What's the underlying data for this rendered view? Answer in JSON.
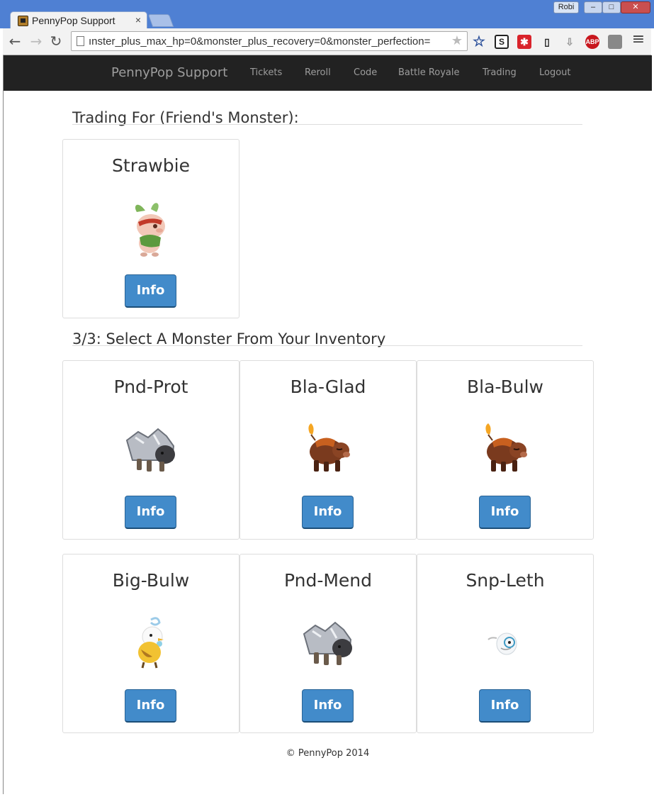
{
  "browser": {
    "tab_title": "PennyPop Support",
    "tab_close": "×",
    "profile_name": "Robi",
    "url": "ınster_plus_max_hp=0&monster_plus_recovery=0&monster_perfection=",
    "back_glyph": "←",
    "forward_glyph": "→",
    "reload_glyph": "↻",
    "menu_glyph": "≡",
    "extensions": [
      "ABP"
    ]
  },
  "nav": {
    "brand": "PennyPop Support",
    "links": [
      "Tickets",
      "Reroll",
      "Code",
      "Battle Royale",
      "Trading",
      "Logout"
    ]
  },
  "trading_for": {
    "title": "Trading For (Friend's Monster):",
    "monster": {
      "name": "Strawbie",
      "button": "Info",
      "icon": "strawbie-pig-icon"
    }
  },
  "inventory": {
    "title": "3/3: Select A Monster From Your Inventory",
    "monsters": [
      {
        "name": "Pnd-Prot",
        "button": "Info",
        "icon": "armored-boar-icon"
      },
      {
        "name": "Bla-Glad",
        "button": "Info",
        "icon": "fire-boar-icon"
      },
      {
        "name": "Bla-Bulw",
        "button": "Info",
        "icon": "fire-boar-icon"
      },
      {
        "name": "Big-Bulw",
        "button": "Info",
        "icon": "wind-bird-icon"
      },
      {
        "name": "Pnd-Mend",
        "button": "Info",
        "icon": "armored-boar-icon"
      },
      {
        "name": "Snp-Leth",
        "button": "Info",
        "icon": "monocle-egg-icon"
      }
    ]
  },
  "footer": {
    "text": "© PennyPop 2014"
  },
  "colors": {
    "navbar": "#222222",
    "button": "#428bca",
    "chrome": "#4f80d3"
  }
}
